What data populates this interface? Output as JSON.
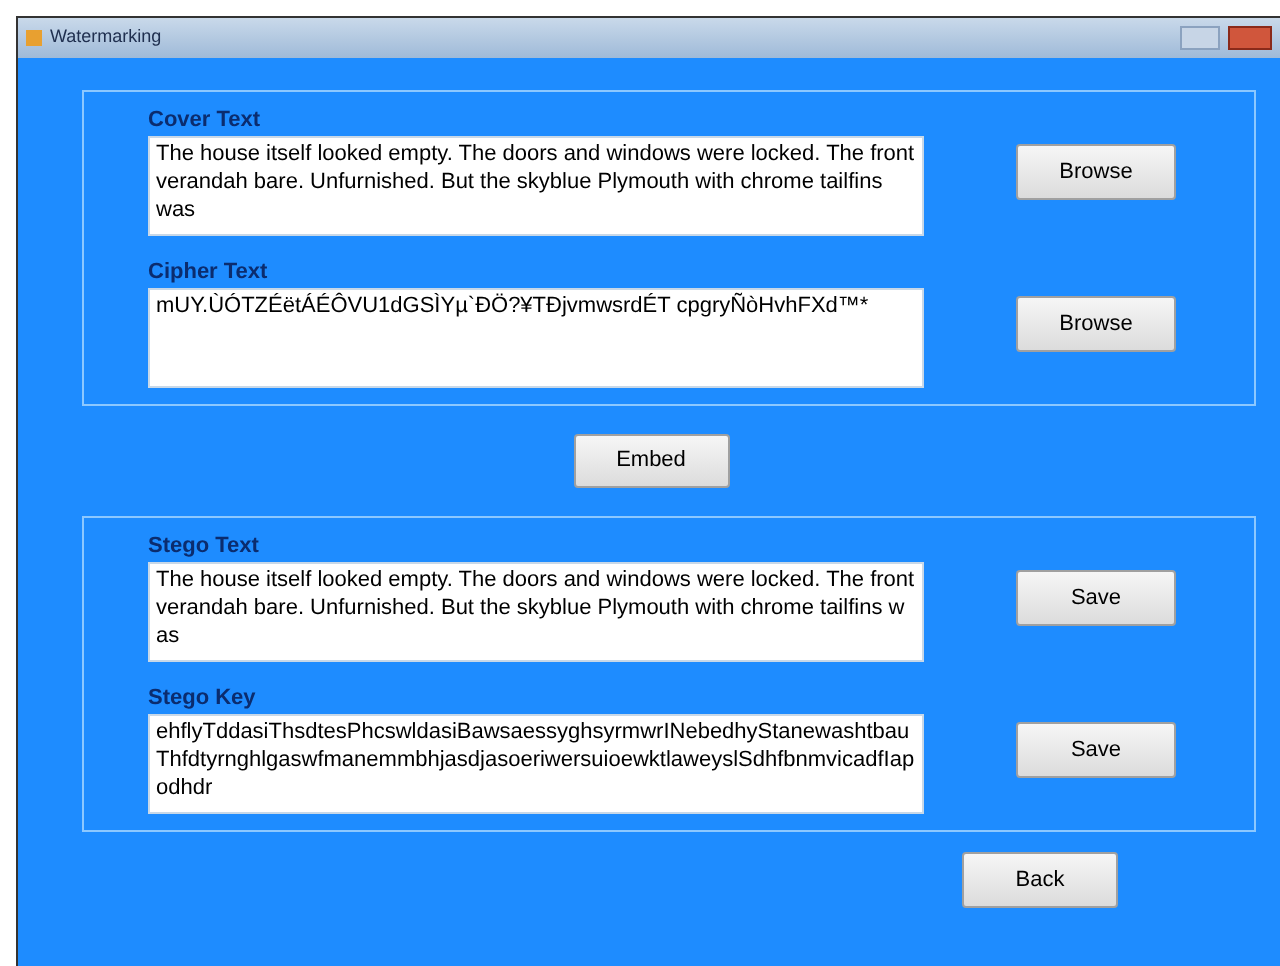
{
  "window": {
    "title": "Watermarking"
  },
  "cover_group": {
    "fields": [
      {
        "label": "Cover Text",
        "value": "The house itself looked empty. The doors and windows were locked. The front verandah bare. Unfurnished. But the skyblue Plymouth with chrome tailfins was",
        "button": "Browse"
      },
      {
        "label": "Cipher Text",
        "value": "mUY.ÙÓTZÉëtÁÉÔVU1dGSÌYµ`ÐÖ?¥TĐjvmwsrdÉT cpgryÑòHvhFXd™*",
        "button": "Browse"
      }
    ]
  },
  "embed_button": "Embed",
  "stego_group": {
    "fields": [
      {
        "label": "Stego Text",
        "value": "The house itself looked empty. The doors and windows were locked. The front verandah bare. Unfurnished. But the skyblue Plymouth with chrome tailfins was",
        "button": "Save"
      },
      {
        "label": "Stego Key",
        "value": "ehflyTddasiThsdtesPhcswldasiBawsaessyghsyrmwrINebedhyStanewashtbauThfdtyrnghlgaswfmanemmbhjasdjasoeriwersuioewktlaweyslSdhfbnmvicadfIapodhdr",
        "button": "Save"
      }
    ]
  },
  "back_button": "Back"
}
